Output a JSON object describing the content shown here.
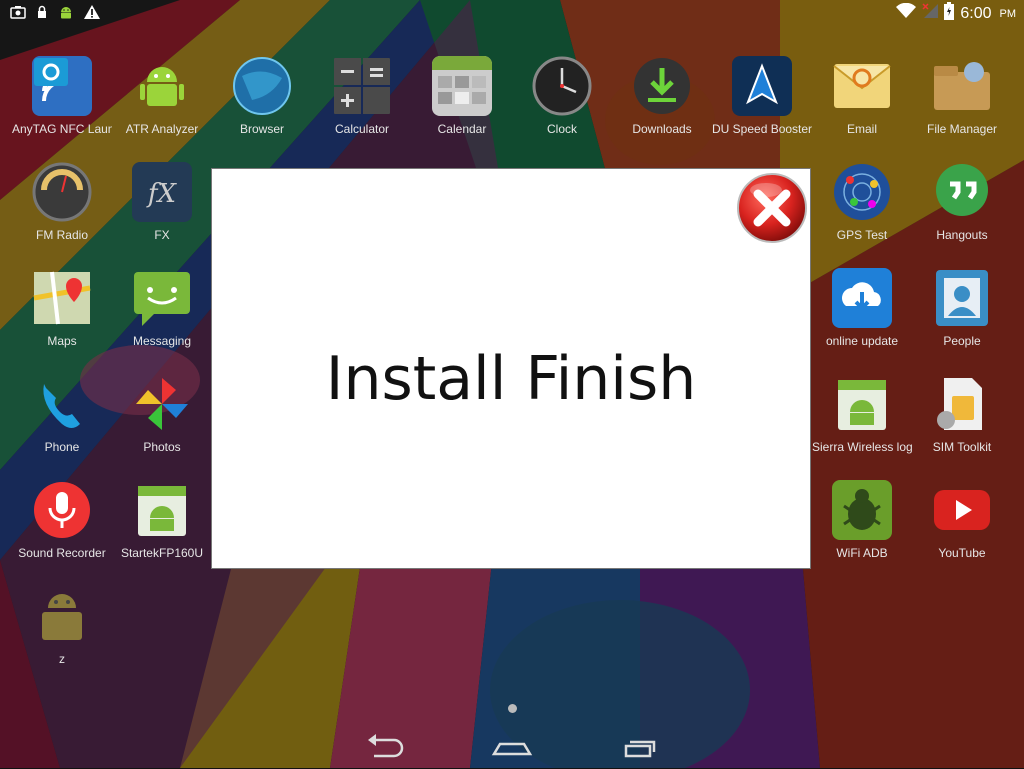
{
  "status_bar": {
    "left_icons": [
      "screenshot-icon",
      "lock-icon",
      "android-debug-icon",
      "warning-icon"
    ],
    "right_icons": [
      "wifi-icon",
      "no-signal-icon",
      "battery-icon"
    ],
    "time": "6:00",
    "ampm": "PM"
  },
  "apps": [
    {
      "label": "AnyTAG NFC Launch",
      "icon": "anytag-nfc-icon",
      "col": 0,
      "row": 0
    },
    {
      "label": "ATR Analyzer",
      "icon": "android-robot-icon",
      "col": 1,
      "row": 0
    },
    {
      "label": "Browser",
      "icon": "globe-icon",
      "col": 2,
      "row": 0
    },
    {
      "label": "Calculator",
      "icon": "calculator-icon",
      "col": 3,
      "row": 0
    },
    {
      "label": "Calendar",
      "icon": "calendar-icon",
      "col": 4,
      "row": 0
    },
    {
      "label": "Clock",
      "icon": "clock-icon",
      "col": 5,
      "row": 0
    },
    {
      "label": "Downloads",
      "icon": "download-icon",
      "col": 6,
      "row": 0
    },
    {
      "label": "DU Speed Booster",
      "icon": "rocket-icon",
      "col": 7,
      "row": 0
    },
    {
      "label": "Email",
      "icon": "email-icon",
      "col": 8,
      "row": 0
    },
    {
      "label": "File Manager",
      "icon": "file-manager-icon",
      "col": 9,
      "row": 0
    },
    {
      "label": "FM Radio",
      "icon": "radio-dial-icon",
      "col": 0,
      "row": 1
    },
    {
      "label": "FX",
      "icon": "fx-icon",
      "col": 1,
      "row": 1
    },
    {
      "label": "GPS Test",
      "icon": "gps-radar-icon",
      "col": 8,
      "row": 1
    },
    {
      "label": "Hangouts",
      "icon": "hangouts-icon",
      "col": 9,
      "row": 1
    },
    {
      "label": "Maps",
      "icon": "map-icon",
      "col": 0,
      "row": 2
    },
    {
      "label": "Messaging",
      "icon": "messaging-icon",
      "col": 1,
      "row": 2
    },
    {
      "label": "online update",
      "icon": "cloud-download-icon",
      "col": 8,
      "row": 2
    },
    {
      "label": "People",
      "icon": "contacts-icon",
      "col": 9,
      "row": 2
    },
    {
      "label": "Phone",
      "icon": "phone-icon",
      "col": 0,
      "row": 3
    },
    {
      "label": "Photos",
      "icon": "pinwheel-icon",
      "col": 1,
      "row": 3
    },
    {
      "label": "Sierra Wireless logs",
      "icon": "android-package-icon",
      "col": 8,
      "row": 3
    },
    {
      "label": "SIM Toolkit",
      "icon": "sim-card-icon",
      "col": 9,
      "row": 3
    },
    {
      "label": "Sound Recorder",
      "icon": "microphone-icon",
      "col": 0,
      "row": 4
    },
    {
      "label": "StartekFP160U",
      "icon": "android-package-icon",
      "col": 1,
      "row": 4
    },
    {
      "label": "WiFi ADB",
      "icon": "bug-icon",
      "col": 8,
      "row": 4
    },
    {
      "label": "YouTube",
      "icon": "youtube-icon",
      "col": 9,
      "row": 4
    },
    {
      "label": "z",
      "icon": "android-robot-box-icon",
      "col": 0,
      "row": 5
    }
  ],
  "dialog": {
    "message": "Install Finish",
    "close_icon": "close-icon"
  },
  "nav": {
    "back_icon": "back-icon",
    "home_icon": "home-icon",
    "recents_icon": "recents-icon"
  },
  "colors": {
    "close_red": "#d9231f",
    "dialog_bg": "#ffffff"
  }
}
